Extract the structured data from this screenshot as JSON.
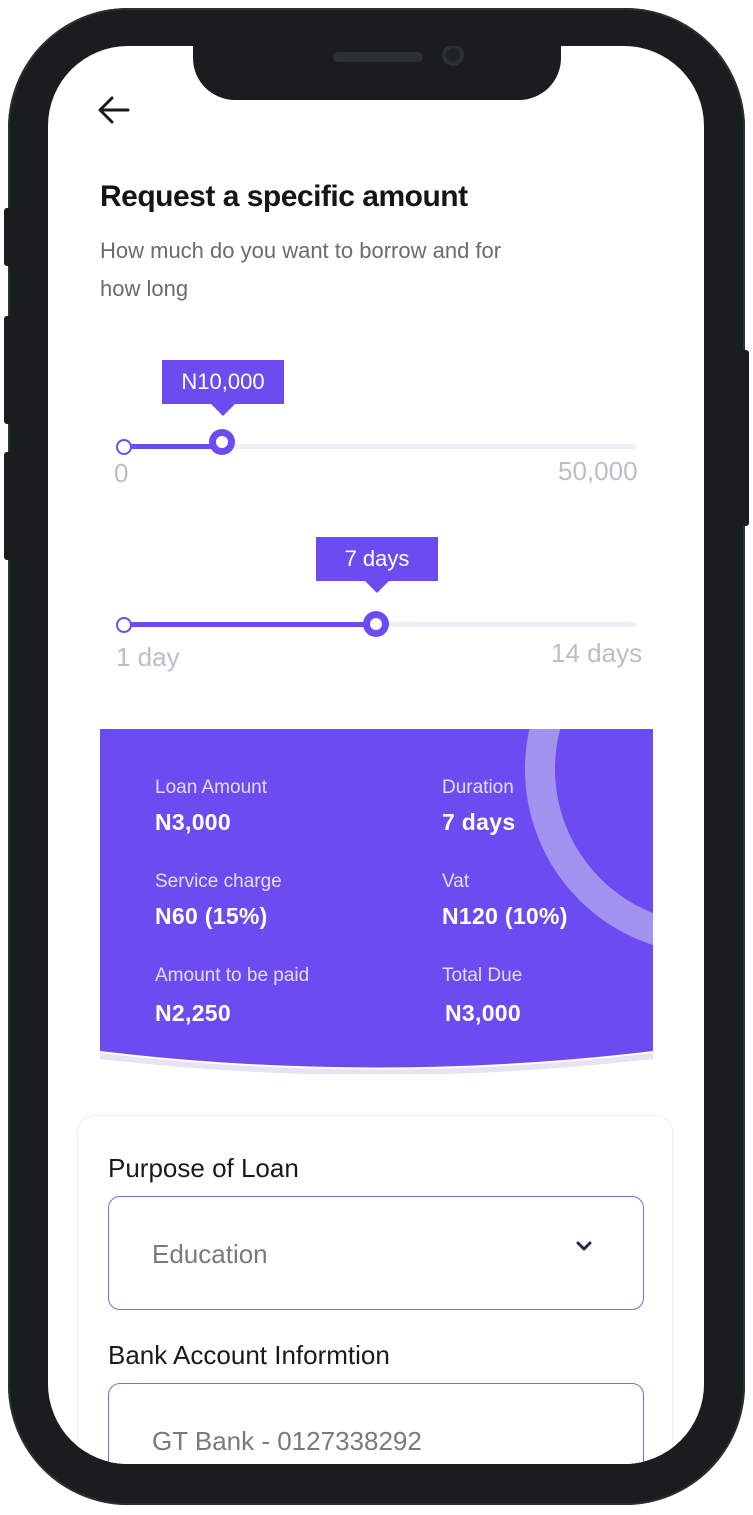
{
  "header": {
    "title": "Request a specific amount",
    "subtitle": "How much do you want to borrow and for how long"
  },
  "amount_slider": {
    "value_label": "N10,000",
    "min_label": "0",
    "max_label": "50,000",
    "fraction": 0.19
  },
  "duration_slider": {
    "value_label": "7 days",
    "min_label": "1 day",
    "max_label": "14 days",
    "fraction": 0.49
  },
  "summary": {
    "loan_amount_label": "Loan Amount",
    "loan_amount_value": "N3,000",
    "duration_label": "Duration",
    "duration_value": "7 days",
    "service_charge_label": "Service charge",
    "service_charge_value": "N60 (15%)",
    "vat_label": "Vat",
    "vat_value": "N120 (10%)",
    "amount_paid_label": "Amount to be paid",
    "amount_paid_value": "N2,250",
    "total_due_label": "Total Due",
    "total_due_value": "N3,000"
  },
  "form": {
    "purpose_label": "Purpose of Loan",
    "purpose_value": "Education",
    "bank_label": "Bank Account Informtion",
    "bank_value": "GT Bank  - 0127338292"
  },
  "icons": {
    "back": "arrow-left-icon",
    "dropdown": "chevron-down-icon"
  },
  "colors": {
    "accent": "#6c4cf1",
    "card": "#6c4cf1",
    "ring": "#a393f0"
  }
}
